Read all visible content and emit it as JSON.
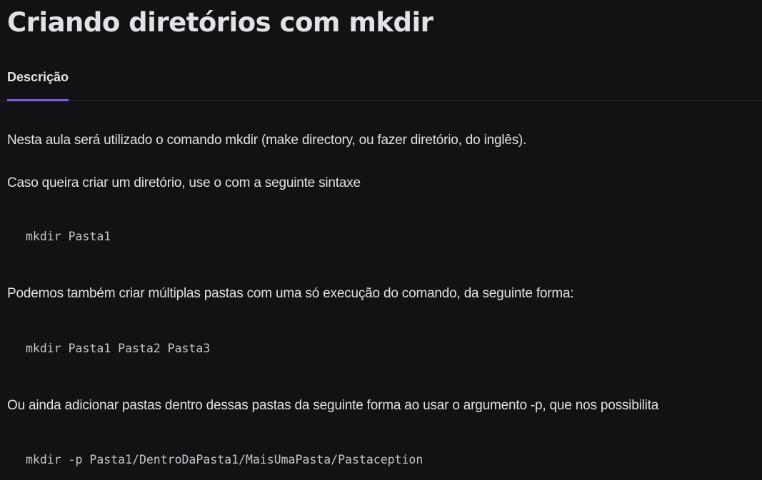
{
  "page": {
    "title": "Criando diretórios com mkdir"
  },
  "tabs": [
    {
      "label": "Descrição",
      "active": true
    }
  ],
  "accent_color": "#8257e5",
  "content": {
    "p1": "Nesta aula será utilizado o comando mkdir (make directory, ou fazer diretório, do inglês).",
    "p2": "Caso queira criar um diretório, use o com a seguinte sintaxe",
    "code1": "mkdir Pasta1",
    "p3": "Podemos também criar múltiplas pastas com uma só execução do comando, da seguinte forma:",
    "code2": "mkdir Pasta1 Pasta2 Pasta3",
    "p4": "Ou ainda adicionar pastas dentro dessas pastas da seguinte forma ao usar o argumento -p, que nos possibilita",
    "code3": "mkdir -p Pasta1/DentroDaPasta1/MaisUmaPasta/Pastaception"
  }
}
